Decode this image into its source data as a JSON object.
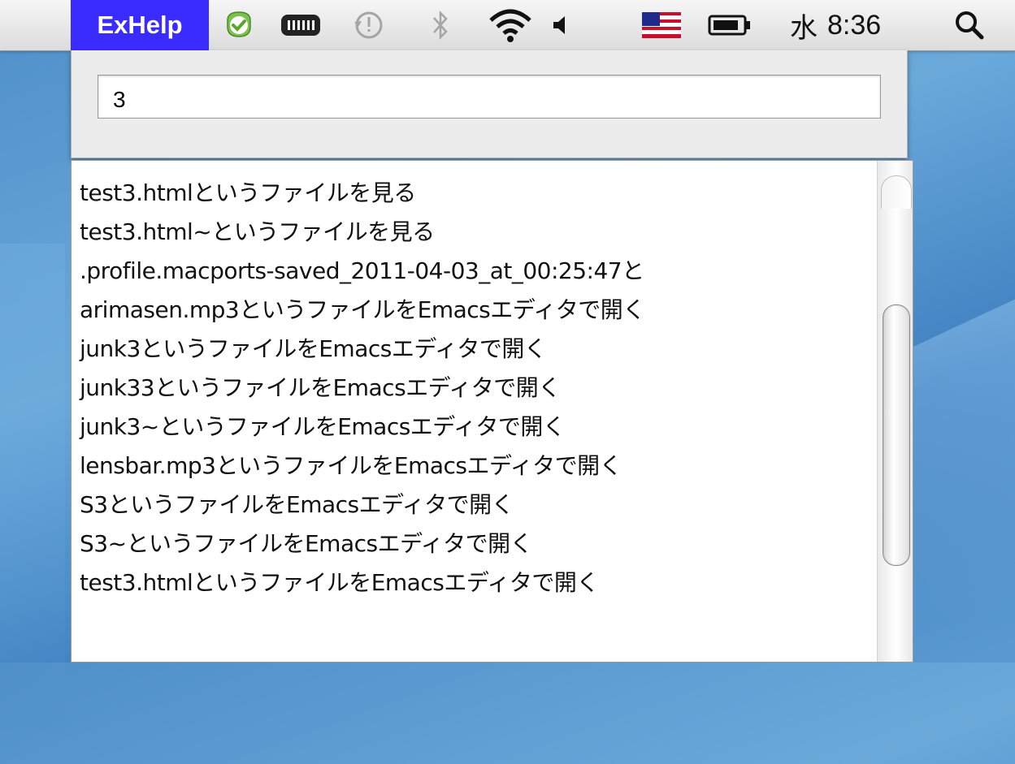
{
  "menubar": {
    "app_name": "ExHelp",
    "day": "水",
    "time": "8:36",
    "icons": [
      "check-badge-icon",
      "battery-meter-icon",
      "time-machine-icon",
      "bluetooth-icon",
      "wifi-icon",
      "volume-icon",
      "us-flag-input-icon",
      "battery-icon",
      "spotlight-search-icon"
    ]
  },
  "search": {
    "value": "3"
  },
  "results": [
    "test3.htmlというファイルを見る",
    "test3.html~というファイルを見る",
    ".profile.macports-saved_2011-04-03_at_00:25:47と",
    "arimasen.mp3というファイルをEmacsエディタで開く",
    "junk3というファイルをEmacsエディタで開く",
    "junk33というファイルをEmacsエディタで開く",
    "junk3~というファイルをEmacsエディタで開く",
    "lensbar.mp3というファイルをEmacsエディタで開く",
    "S3というファイルをEmacsエディタで開く",
    "S3~というファイルをEmacsエディタで開く",
    "test3.htmlというファイルをEmacsエディタで開く"
  ],
  "colors": {
    "app_chip": "#3a2cff",
    "desktop": "#4f8fc8"
  }
}
